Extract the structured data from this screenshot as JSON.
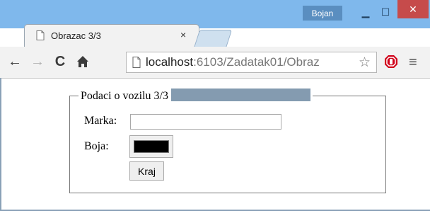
{
  "window": {
    "user_badge": "Bojan",
    "minimize_icon": "minimize-icon",
    "maximize_icon": "maximize-icon",
    "close_icon": "close-icon"
  },
  "tab": {
    "title": "Obrazac 3/3",
    "close_label": "×",
    "icon": "page-icon"
  },
  "toolbar": {
    "back_icon": "back-arrow-icon",
    "forward_icon": "forward-arrow-icon",
    "reload_icon": "reload-icon",
    "home_icon": "home-icon",
    "url_host": "localhost",
    "url_path": ":6103/Zadatak01/Obraz",
    "star_icon": "star-icon",
    "extension_icon": "stop-sign-icon",
    "menu_icon": "hamburger-menu-icon"
  },
  "form": {
    "legend": "Podaci o vozilu 3/3",
    "marka_label": "Marka:",
    "marka_value": "",
    "boja_label": "Boja:",
    "boja_value": "#000000",
    "submit_label": "Kraj"
  },
  "colors": {
    "titlebar": "#7fb8ec",
    "close_button": "#c64b4b",
    "legend_bar": "#849bb0"
  }
}
